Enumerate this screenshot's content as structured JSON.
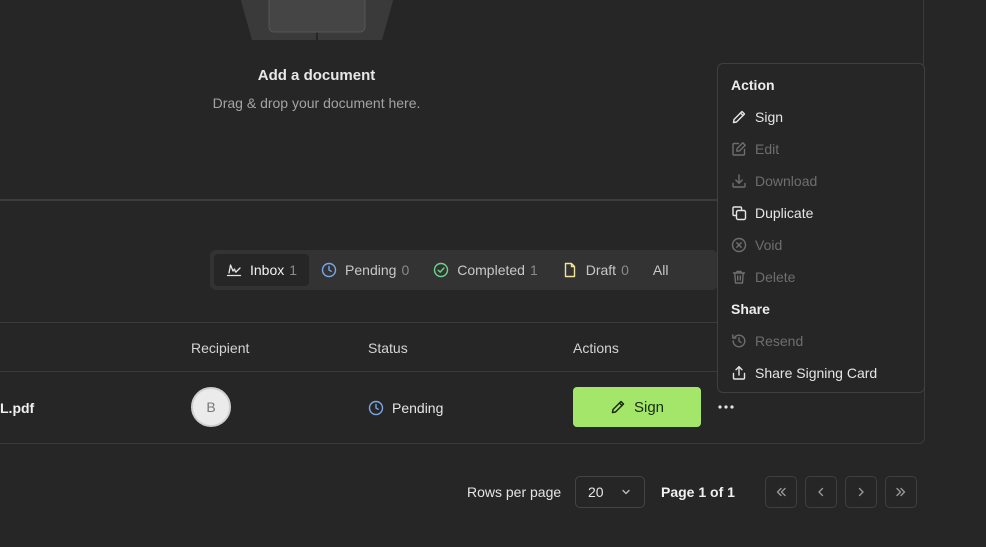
{
  "upload": {
    "title": "Add a document",
    "subtitle": "Drag & drop your document here."
  },
  "tabs": [
    {
      "label": "Inbox",
      "count": "1",
      "icon": "signature-icon",
      "active": true
    },
    {
      "label": "Pending",
      "count": "0",
      "icon": "clock-icon",
      "active": false
    },
    {
      "label": "Completed",
      "count": "1",
      "icon": "check-circle-icon",
      "active": false
    },
    {
      "label": "Draft",
      "count": "0",
      "icon": "file-icon",
      "active": false
    },
    {
      "label": "All",
      "count": "",
      "icon": "",
      "active": false
    }
  ],
  "table": {
    "headers": {
      "recipient": "Recipient",
      "status": "Status",
      "actions": "Actions"
    },
    "rows": [
      {
        "file": "L.pdf",
        "recipient_initial": "B",
        "status": "Pending",
        "action_label": "Sign"
      }
    ]
  },
  "pagination": {
    "rows_per_page_label": "Rows per page",
    "rows_per_page_value": "20",
    "page_info": "Page 1 of 1"
  },
  "menu": {
    "section_action": "Action",
    "section_share": "Share",
    "items": [
      {
        "label": "Sign",
        "icon": "pencil-icon",
        "disabled": false
      },
      {
        "label": "Edit",
        "icon": "edit-icon",
        "disabled": true
      },
      {
        "label": "Download",
        "icon": "download-icon",
        "disabled": true
      },
      {
        "label": "Duplicate",
        "icon": "copy-icon",
        "disabled": false
      },
      {
        "label": "Void",
        "icon": "x-circle-icon",
        "disabled": true
      },
      {
        "label": "Delete",
        "icon": "trash-icon",
        "disabled": true
      }
    ],
    "share_items": [
      {
        "label": "Resend",
        "icon": "history-icon",
        "disabled": true
      },
      {
        "label": "Share Signing Card",
        "icon": "share-icon",
        "disabled": false
      }
    ]
  },
  "colors": {
    "background": "#262626",
    "accent_green": "#a3e669",
    "pending_blue": "#7aa7e6",
    "completed_green": "#6dd48a",
    "draft_yellow": "#f2e49b"
  }
}
